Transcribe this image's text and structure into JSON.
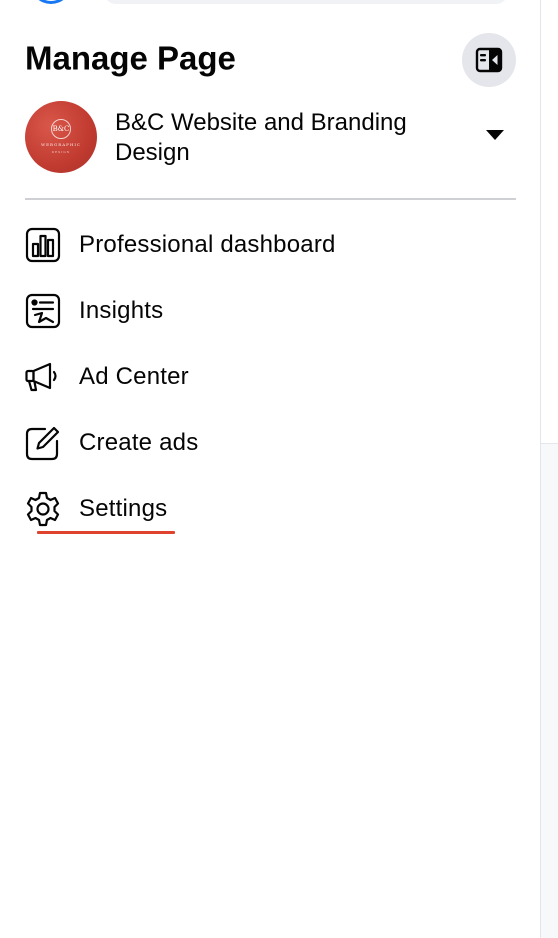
{
  "panel": {
    "title": "Manage Page",
    "collapse_icon": "sidebar-collapse-icon"
  },
  "page_switcher": {
    "name": "B&C Website and Branding Design",
    "avatar": {
      "monogram": "B&C",
      "line": "WEBGRAPHIC",
      "subline": "DESIGN"
    },
    "caret_icon": "caret-down-icon"
  },
  "menu": {
    "items": [
      {
        "label": "Professional dashboard",
        "icon": "dashboard-icon"
      },
      {
        "label": "Insights",
        "icon": "insights-icon"
      },
      {
        "label": "Ad Center",
        "icon": "megaphone-icon"
      },
      {
        "label": "Create ads",
        "icon": "edit-icon"
      },
      {
        "label": "Settings",
        "icon": "gear-icon",
        "active": true
      }
    ]
  },
  "colors": {
    "brand_blue": "#1877f2",
    "active_underline": "#e0432d",
    "avatar_red": "#c13b30",
    "divider": "#ced0d4",
    "button_bg": "#e4e6eb"
  }
}
